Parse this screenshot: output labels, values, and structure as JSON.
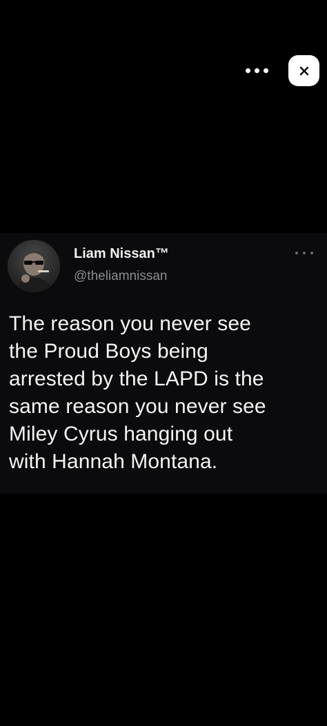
{
  "toolbar": {
    "more_icon": "more-horizontal-icon",
    "close_icon": "close-x-icon"
  },
  "tweet": {
    "author": {
      "display_name": "Liam Nissan™",
      "handle": "@theliamnissan"
    },
    "more_icon": "more-horizontal-icon",
    "text_lines": [
      "The reason you never see",
      "the Proud Boys being",
      "arrested by the LAPD is the",
      "same reason you never see",
      "Miley Cyrus hanging out",
      "with Hannah Montana."
    ]
  },
  "colors": {
    "background": "#000000",
    "card_background": "#0b0b0d",
    "text_primary": "#f5f5f5",
    "text_secondary": "#8a8d91",
    "close_button_bg": "#ffffff"
  }
}
